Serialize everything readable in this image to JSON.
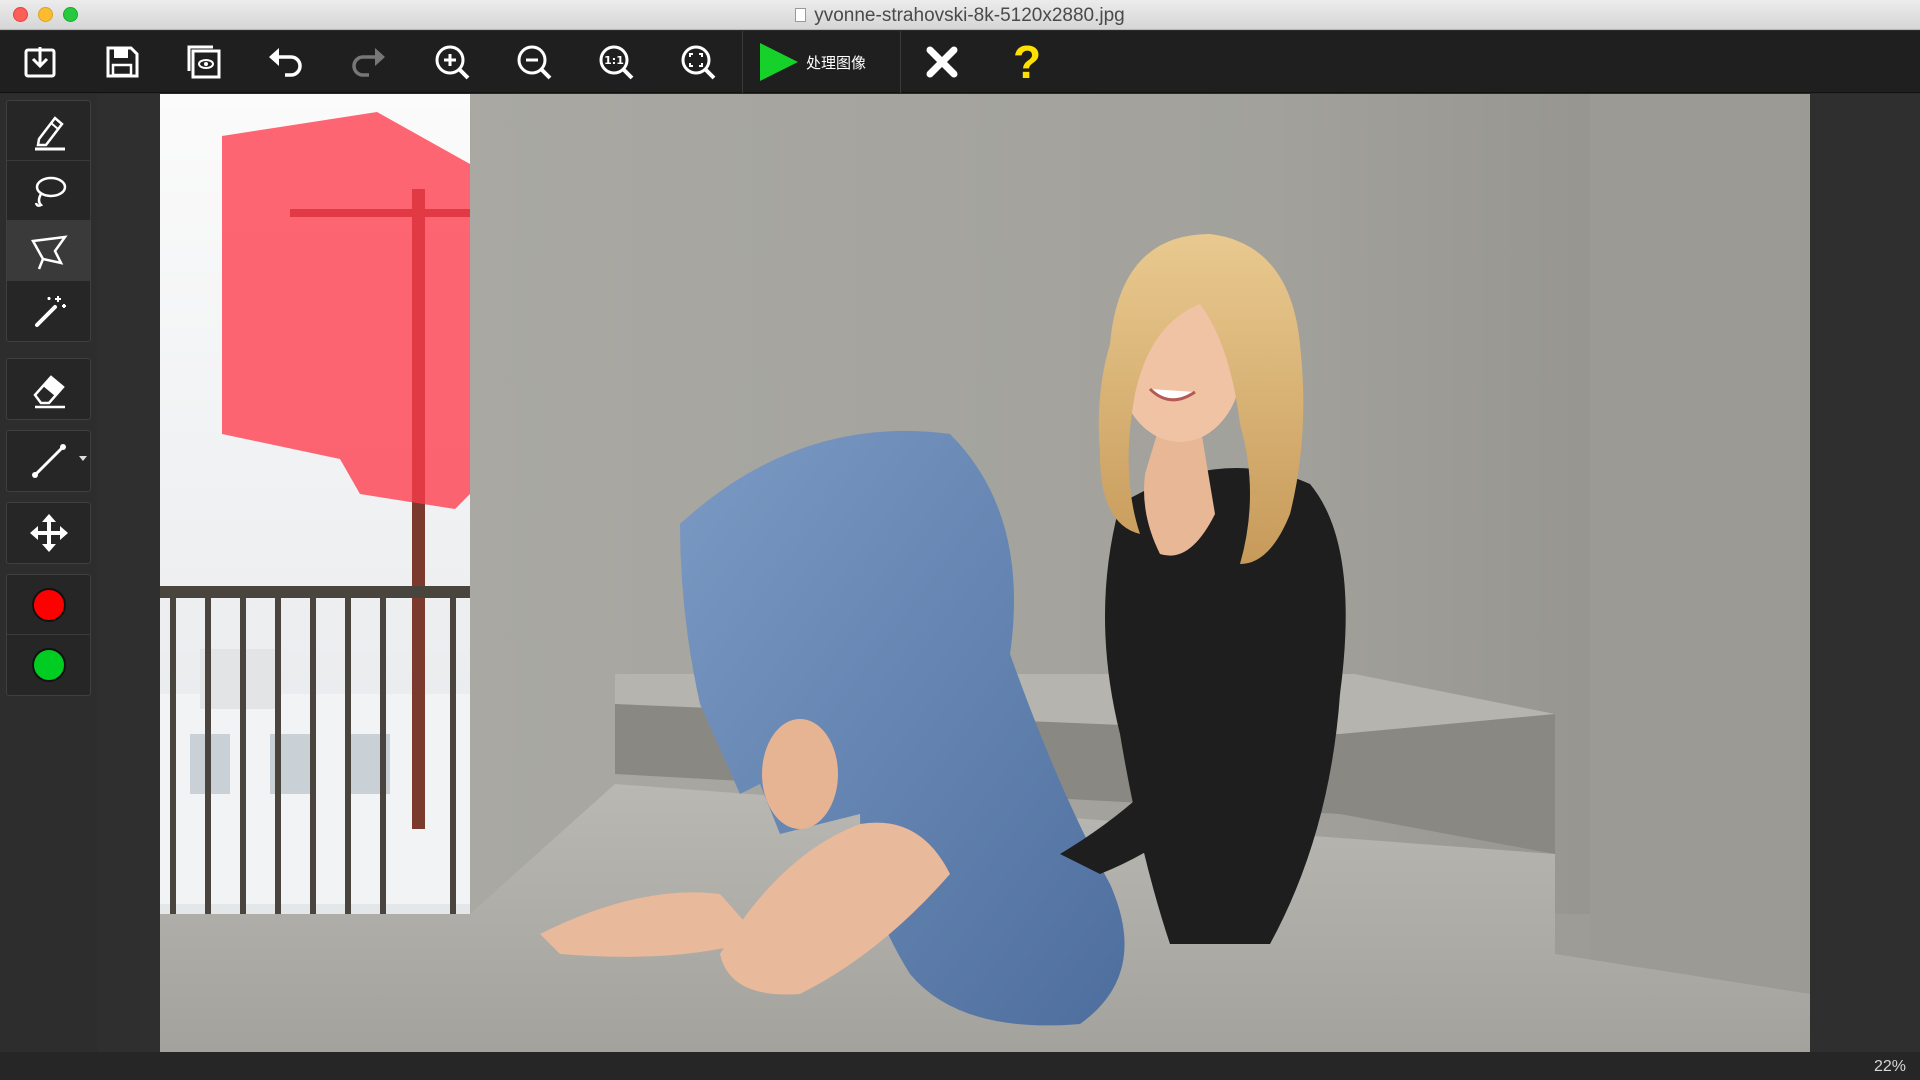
{
  "window": {
    "title": "yvonne-strahovski-8k-5120x2880.jpg"
  },
  "toolbar": {
    "process_label": "处理图像",
    "help_label": "?",
    "buttons": [
      "import-icon",
      "save-icon",
      "preview-icon",
      "undo-icon",
      "redo-icon",
      "zoom-in-icon",
      "zoom-out-icon",
      "actual-size-icon",
      "fit-screen-icon",
      "play-icon",
      "close-icon"
    ]
  },
  "sidebar": {
    "tools": [
      "marker-icon",
      "lasso-icon",
      "polygon-lasso-icon",
      "magic-wand-icon",
      "eraser-icon",
      "line-icon",
      "move-icon"
    ],
    "active_tool": "polygon-lasso-icon",
    "colors": {
      "remove": "#ff0000",
      "keep": "#00cc22"
    }
  },
  "canvas": {
    "mask_color": "#ff3b4b"
  },
  "status": {
    "zoom": "22%"
  }
}
